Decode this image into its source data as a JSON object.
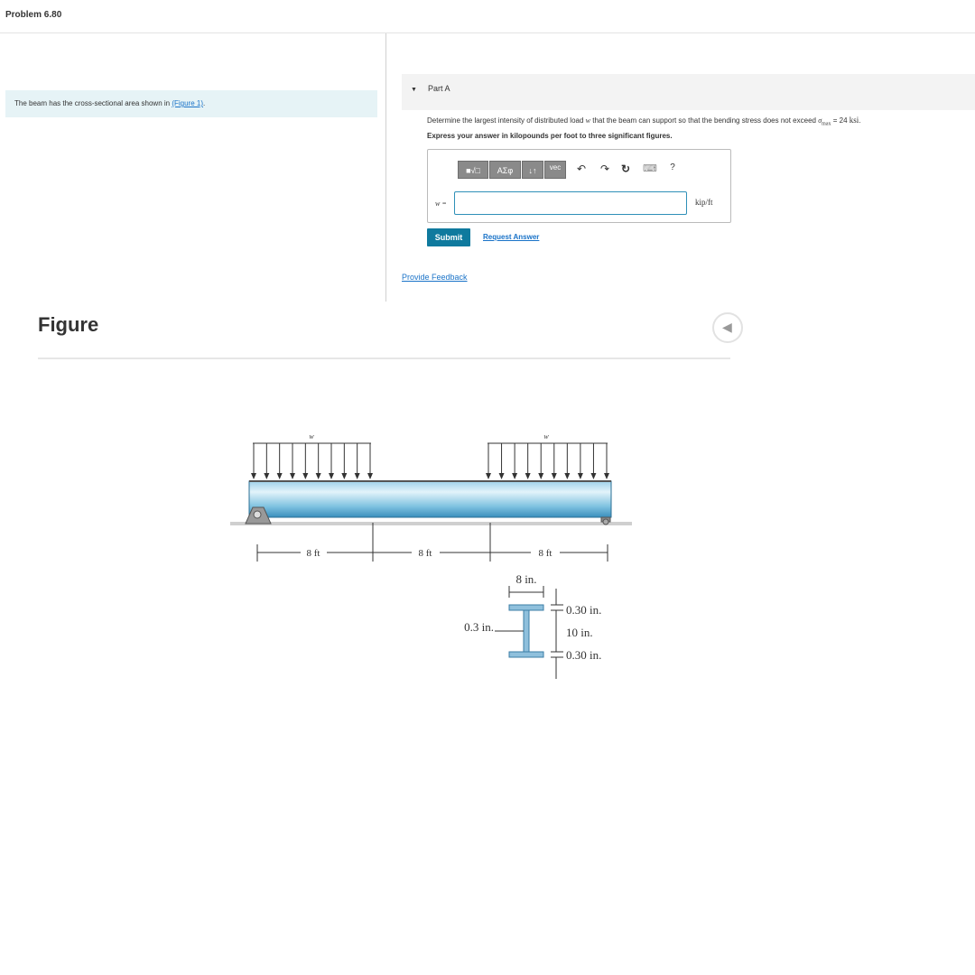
{
  "header": {
    "title": "Problem 6.80"
  },
  "intro": {
    "text": "The beam has the cross-sectional area shown in",
    "link": "(Figure 1)",
    "after": "."
  },
  "part_a": {
    "label": "Part A",
    "question_prefix": "Determine the largest intensity of distributed load",
    "question_var": "w",
    "question_mid": "that the beam can support so that the bending stress does not exceed",
    "sigma_symbol": "σ",
    "sigma_sub": "max",
    "question_eq": "= 24",
    "question_unit": "ksi",
    "question_end": ".",
    "instruction": "Express your answer in kilopounds per foot to three significant figures."
  },
  "answer": {
    "toolbar": {
      "template": "■√□",
      "symbols": "ΑΣφ",
      "arrows": "↓↑",
      "vec": "vec",
      "undo": "↶",
      "redo": "↷",
      "reset": "↻",
      "keyboard": "⌨",
      "help": "?"
    },
    "variable_label": "w =",
    "value": "",
    "unit": "kip/ft"
  },
  "buttons": {
    "submit": "Submit",
    "request_answer": "Request Answer",
    "feedback": "Provide Feedback"
  },
  "figure": {
    "heading": "Figure",
    "load_labels": [
      "w",
      "w"
    ],
    "spans": [
      "8 ft",
      "8 ft",
      "8 ft"
    ],
    "flange_width": "8 in.",
    "flange_top": "0.30 in.",
    "web_height": "10 in.",
    "flange_bottom": "0.30 in.",
    "web_thickness": "0.3 in.",
    "colors": {
      "beam_light": "#d4ecf6",
      "beam_mid": "#8ccbe6",
      "beam_dark": "#3d9bc4",
      "section": "#8fc0dc"
    }
  }
}
